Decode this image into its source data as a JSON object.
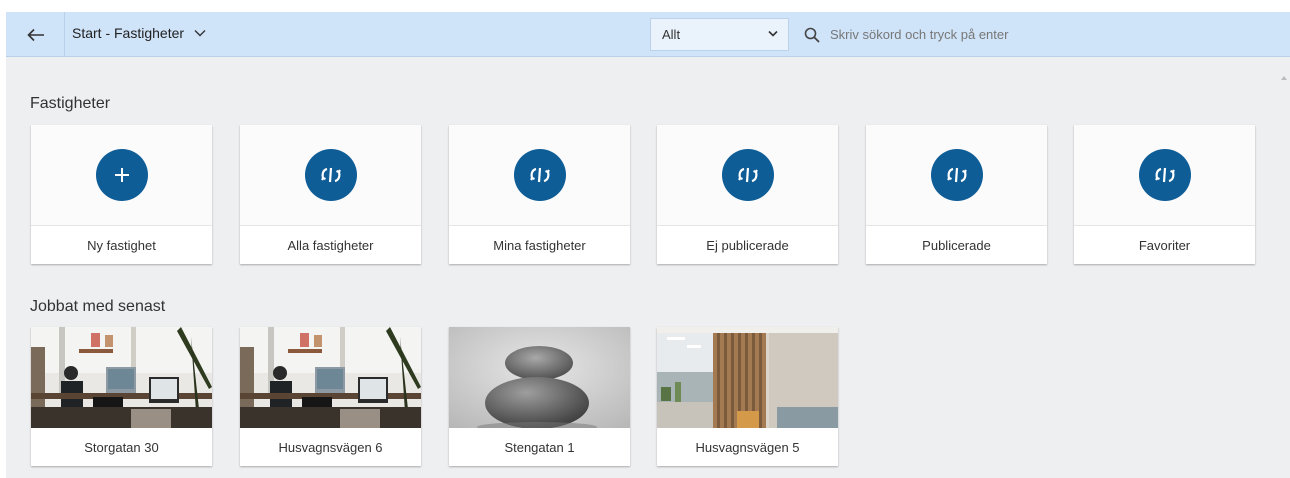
{
  "header": {
    "breadcrumb": "Start - Fastigheter",
    "filter_value": "Allt",
    "search_placeholder": "Skriv sökord och tryck på enter"
  },
  "sections": {
    "fastigheter_title": "Fastigheter",
    "recent_title": "Jobbat med senast"
  },
  "tiles": [
    {
      "label": "Ny fastighet",
      "icon": "plus-icon"
    },
    {
      "label": "Alla fastigheter",
      "icon": "refresh-icon"
    },
    {
      "label": "Mina fastigheter",
      "icon": "refresh-icon"
    },
    {
      "label": "Ej publicerade",
      "icon": "refresh-icon"
    },
    {
      "label": "Publicerade",
      "icon": "refresh-icon"
    },
    {
      "label": "Favoriter",
      "icon": "refresh-icon"
    }
  ],
  "recent": [
    {
      "label": "Storgatan 30",
      "image": "office-photo"
    },
    {
      "label": "Husvagnsvägen 6",
      "image": "office-photo"
    },
    {
      "label": "Stengatan 1",
      "image": "stones-photo"
    },
    {
      "label": "Husvagnsvägen 5",
      "image": "interior-photo"
    }
  ],
  "colors": {
    "header_bg": "#cfe3f9",
    "accent": "#0f5d97",
    "page_bg": "#eeeff1"
  }
}
